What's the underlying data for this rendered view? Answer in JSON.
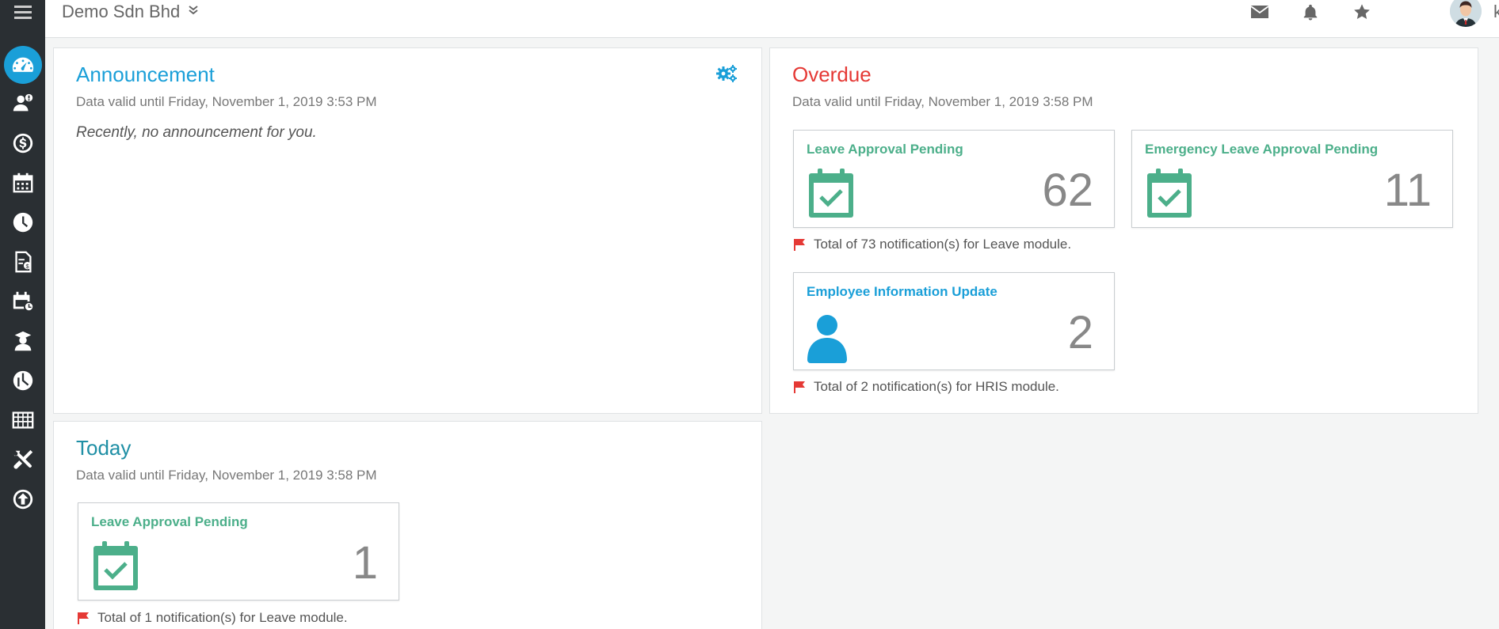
{
  "topbar": {
    "company": "Demo Sdn Bhd",
    "username": "kas"
  },
  "announcement": {
    "title": "Announcement",
    "valid": "Data valid until Friday, November 1, 2019 3:53 PM",
    "empty_text": "Recently, no announcement for you."
  },
  "overdue": {
    "title": "Overdue",
    "valid": "Data valid until Friday, November 1, 2019 3:58 PM",
    "cards": [
      {
        "title": "Leave Approval Pending",
        "count": "62"
      },
      {
        "title": "Emergency Leave Approval Pending",
        "count": "11"
      },
      {
        "title": "Employee Information Update",
        "count": "2"
      }
    ],
    "notes": [
      "Total of 73 notification(s) for Leave module.",
      "Total of 2 notification(s) for HRIS module."
    ]
  },
  "today": {
    "title": "Today",
    "valid": "Data valid until Friday, November 1, 2019 3:58 PM",
    "cards": [
      {
        "title": "Leave Approval Pending",
        "count": "1"
      }
    ],
    "notes": [
      "Total of 1 notification(s) for Leave module."
    ]
  },
  "colors": {
    "accent": "#1a9fd8",
    "green": "#4caf8a",
    "red": "#e53935",
    "teal": "#1f8fa5"
  },
  "sidebar_icons": [
    "menu-icon",
    "dashboard-icon",
    "employee-icon",
    "payroll-icon",
    "calendar-icon",
    "clock-icon",
    "claim-icon",
    "schedule-icon",
    "training-icon",
    "report-icon",
    "table-icon",
    "tools-icon",
    "upload-icon"
  ]
}
